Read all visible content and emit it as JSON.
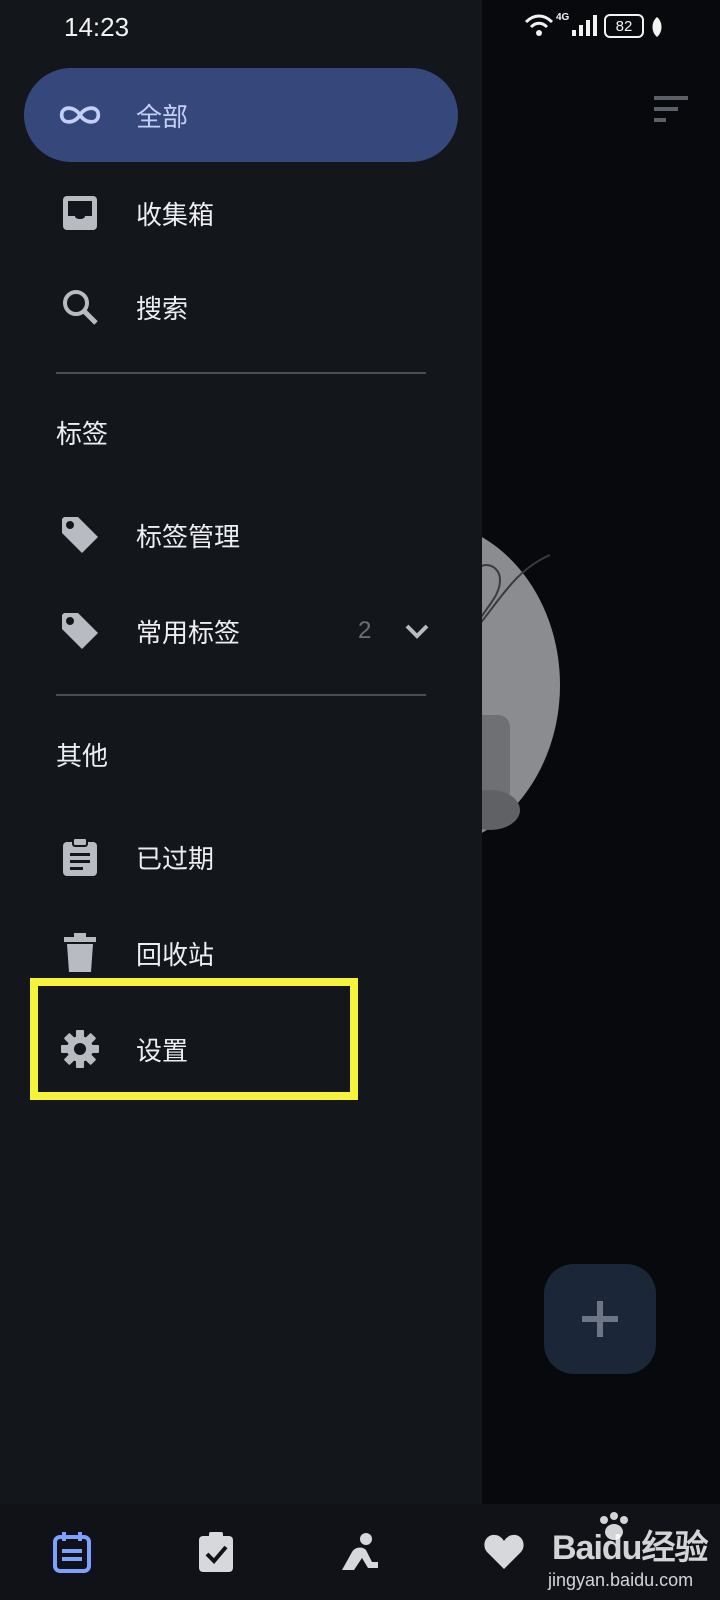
{
  "status_bar": {
    "time": "14:23",
    "network": "4G",
    "battery": "82"
  },
  "drawer": {
    "items": [
      {
        "label": "全部",
        "icon": "infinity-icon",
        "active": true
      },
      {
        "label": "收集箱",
        "icon": "inbox-icon"
      },
      {
        "label": "搜索",
        "icon": "search-icon"
      }
    ],
    "tags_section": {
      "title": "标签",
      "items": [
        {
          "label": "标签管理",
          "icon": "tag-icon"
        },
        {
          "label": "常用标签",
          "icon": "tag-icon",
          "count": "2"
        }
      ]
    },
    "other_section": {
      "title": "其他",
      "items": [
        {
          "label": "已过期",
          "icon": "clipboard-icon"
        },
        {
          "label": "回收站",
          "icon": "trash-icon"
        },
        {
          "label": "设置",
          "icon": "gear-icon",
          "highlighted": true
        }
      ]
    }
  },
  "watermark": {
    "brand": "Baidu经验",
    "url": "jingyan.baidu.com"
  },
  "colors": {
    "drawer_bg": "#13161b",
    "active_item_bg": "#36487b",
    "highlight": "#f7f33a",
    "accent": "#7ea0ff"
  }
}
